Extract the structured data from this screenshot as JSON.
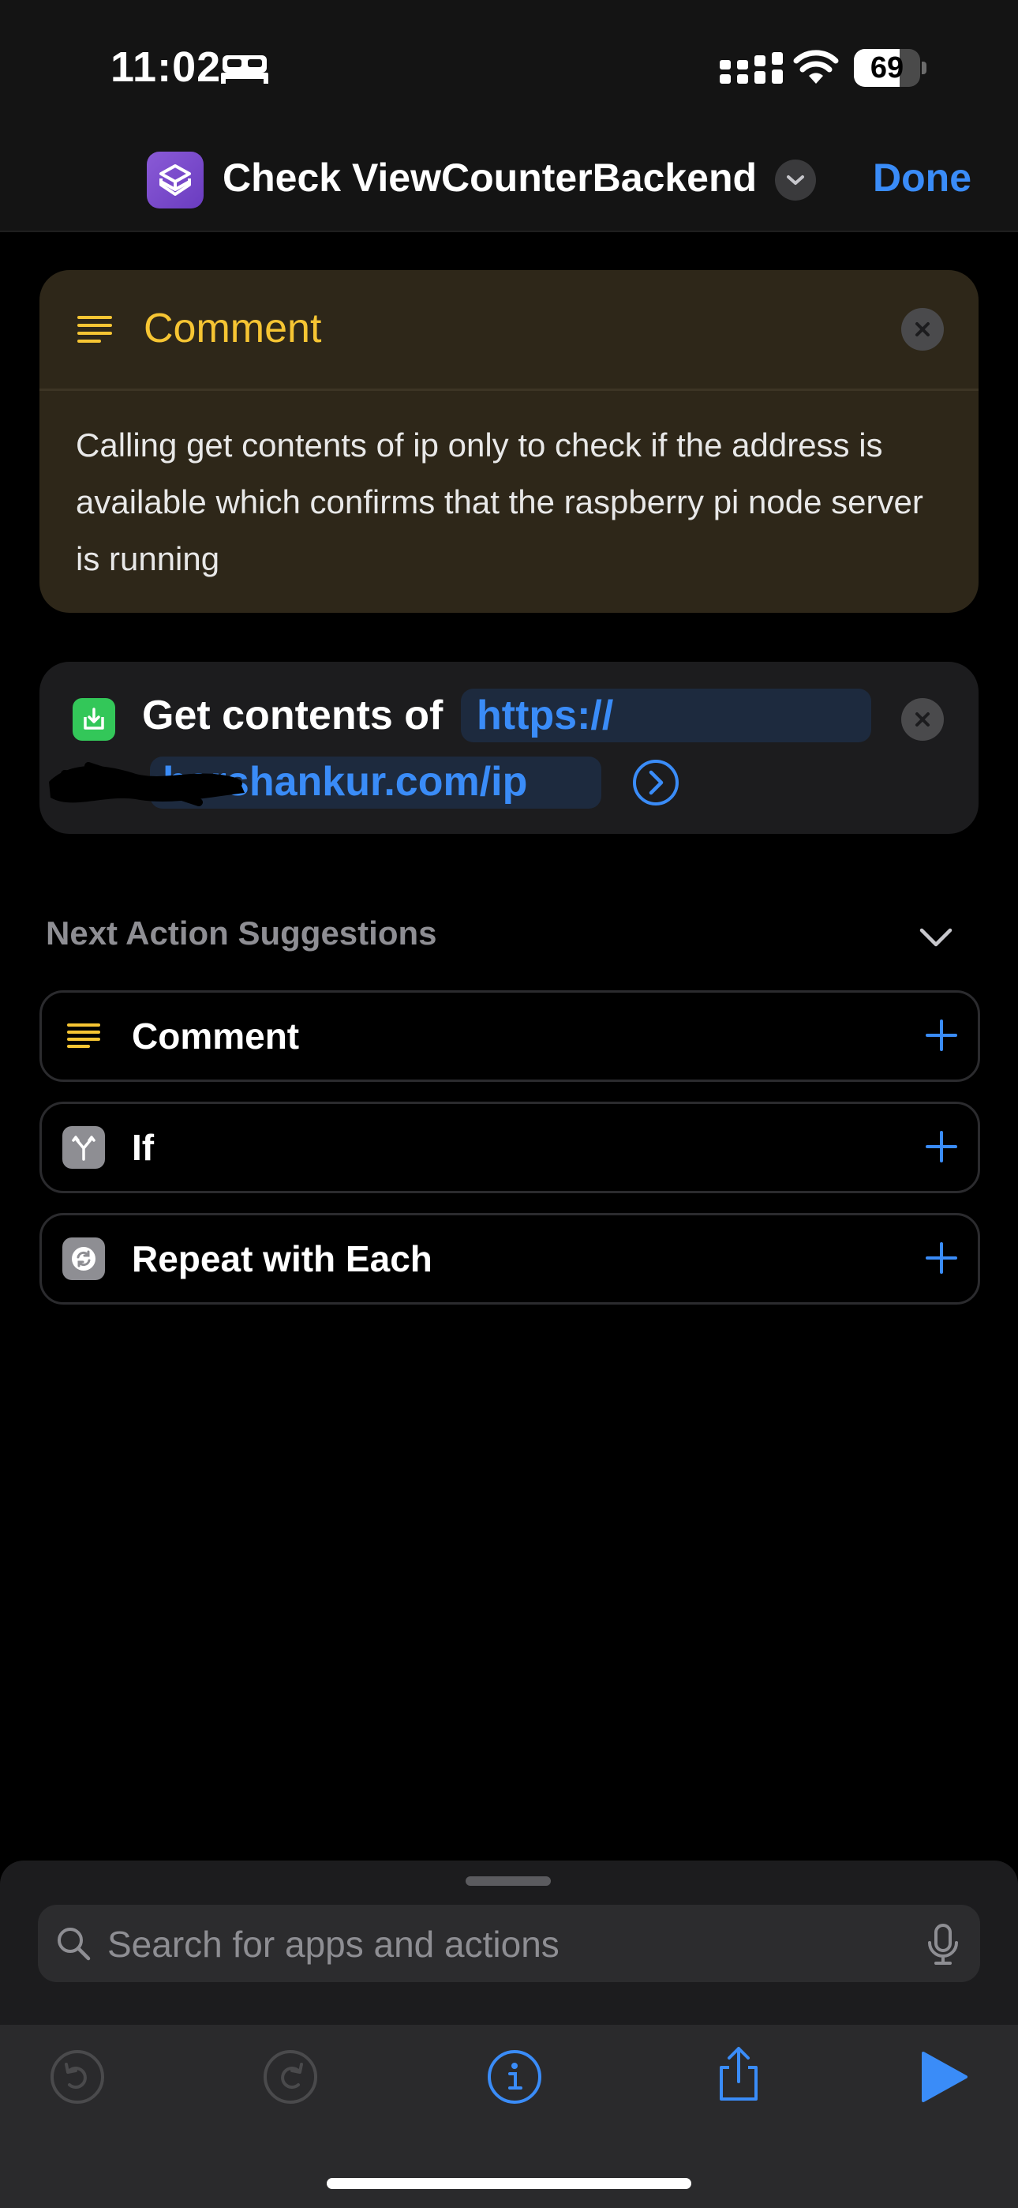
{
  "status_bar": {
    "time": "11:02",
    "battery_level": "69",
    "icons": [
      "bed-icon",
      "cellular-signal-icon",
      "wifi-icon",
      "battery-icon"
    ]
  },
  "header": {
    "title": "Check ViewCounterBackend",
    "done_label": "Done",
    "accent_color": "#3a8cf8",
    "app_icon": "shortcuts-icon"
  },
  "comment_action": {
    "title": "Comment",
    "body": "Calling get contents of ip only to check if the address is available which confirms that the raspberry pi node server is running",
    "title_color": "#f6c533"
  },
  "get_contents_action": {
    "label": "Get contents of",
    "url_line1": "https://",
    "url_line2": "harshankur.com/ip"
  },
  "suggestions": {
    "title": "Next Action Suggestions",
    "items": [
      {
        "label": "Comment",
        "icon": "comment-lines-icon"
      },
      {
        "label": "If",
        "icon": "if-branch-icon"
      },
      {
        "label": "Repeat with Each",
        "icon": "repeat-icon"
      }
    ]
  },
  "search": {
    "placeholder": "Search for apps and actions"
  },
  "toolbar": {
    "icons": [
      "undo-icon",
      "redo-icon",
      "info-icon",
      "share-icon",
      "play-icon"
    ]
  }
}
